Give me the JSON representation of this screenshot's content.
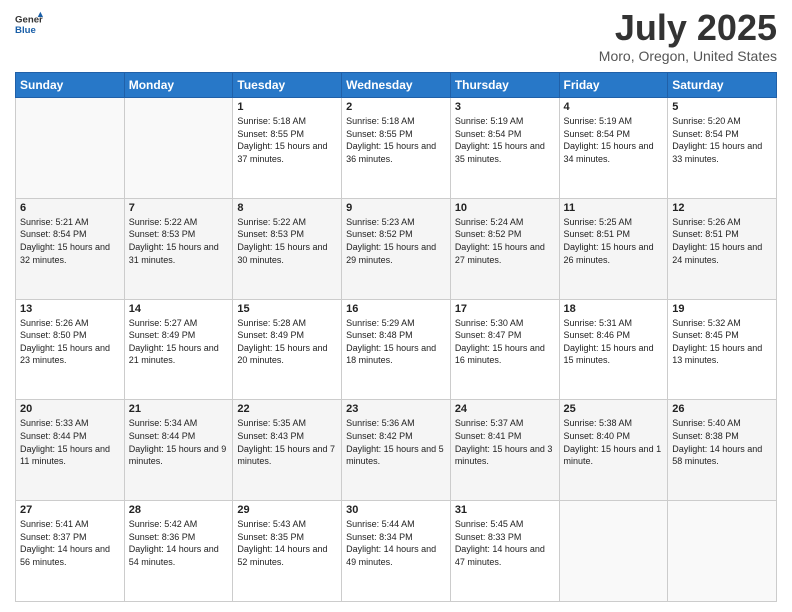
{
  "header": {
    "logo_line1": "General",
    "logo_line2": "Blue",
    "month": "July 2025",
    "location": "Moro, Oregon, United States"
  },
  "weekdays": [
    "Sunday",
    "Monday",
    "Tuesday",
    "Wednesday",
    "Thursday",
    "Friday",
    "Saturday"
  ],
  "weeks": [
    [
      {
        "day": "",
        "sunrise": "",
        "sunset": "",
        "daylight": ""
      },
      {
        "day": "",
        "sunrise": "",
        "sunset": "",
        "daylight": ""
      },
      {
        "day": "1",
        "sunrise": "Sunrise: 5:18 AM",
        "sunset": "Sunset: 8:55 PM",
        "daylight": "Daylight: 15 hours and 37 minutes."
      },
      {
        "day": "2",
        "sunrise": "Sunrise: 5:18 AM",
        "sunset": "Sunset: 8:55 PM",
        "daylight": "Daylight: 15 hours and 36 minutes."
      },
      {
        "day": "3",
        "sunrise": "Sunrise: 5:19 AM",
        "sunset": "Sunset: 8:54 PM",
        "daylight": "Daylight: 15 hours and 35 minutes."
      },
      {
        "day": "4",
        "sunrise": "Sunrise: 5:19 AM",
        "sunset": "Sunset: 8:54 PM",
        "daylight": "Daylight: 15 hours and 34 minutes."
      },
      {
        "day": "5",
        "sunrise": "Sunrise: 5:20 AM",
        "sunset": "Sunset: 8:54 PM",
        "daylight": "Daylight: 15 hours and 33 minutes."
      }
    ],
    [
      {
        "day": "6",
        "sunrise": "Sunrise: 5:21 AM",
        "sunset": "Sunset: 8:54 PM",
        "daylight": "Daylight: 15 hours and 32 minutes."
      },
      {
        "day": "7",
        "sunrise": "Sunrise: 5:22 AM",
        "sunset": "Sunset: 8:53 PM",
        "daylight": "Daylight: 15 hours and 31 minutes."
      },
      {
        "day": "8",
        "sunrise": "Sunrise: 5:22 AM",
        "sunset": "Sunset: 8:53 PM",
        "daylight": "Daylight: 15 hours and 30 minutes."
      },
      {
        "day": "9",
        "sunrise": "Sunrise: 5:23 AM",
        "sunset": "Sunset: 8:52 PM",
        "daylight": "Daylight: 15 hours and 29 minutes."
      },
      {
        "day": "10",
        "sunrise": "Sunrise: 5:24 AM",
        "sunset": "Sunset: 8:52 PM",
        "daylight": "Daylight: 15 hours and 27 minutes."
      },
      {
        "day": "11",
        "sunrise": "Sunrise: 5:25 AM",
        "sunset": "Sunset: 8:51 PM",
        "daylight": "Daylight: 15 hours and 26 minutes."
      },
      {
        "day": "12",
        "sunrise": "Sunrise: 5:26 AM",
        "sunset": "Sunset: 8:51 PM",
        "daylight": "Daylight: 15 hours and 24 minutes."
      }
    ],
    [
      {
        "day": "13",
        "sunrise": "Sunrise: 5:26 AM",
        "sunset": "Sunset: 8:50 PM",
        "daylight": "Daylight: 15 hours and 23 minutes."
      },
      {
        "day": "14",
        "sunrise": "Sunrise: 5:27 AM",
        "sunset": "Sunset: 8:49 PM",
        "daylight": "Daylight: 15 hours and 21 minutes."
      },
      {
        "day": "15",
        "sunrise": "Sunrise: 5:28 AM",
        "sunset": "Sunset: 8:49 PM",
        "daylight": "Daylight: 15 hours and 20 minutes."
      },
      {
        "day": "16",
        "sunrise": "Sunrise: 5:29 AM",
        "sunset": "Sunset: 8:48 PM",
        "daylight": "Daylight: 15 hours and 18 minutes."
      },
      {
        "day": "17",
        "sunrise": "Sunrise: 5:30 AM",
        "sunset": "Sunset: 8:47 PM",
        "daylight": "Daylight: 15 hours and 16 minutes."
      },
      {
        "day": "18",
        "sunrise": "Sunrise: 5:31 AM",
        "sunset": "Sunset: 8:46 PM",
        "daylight": "Daylight: 15 hours and 15 minutes."
      },
      {
        "day": "19",
        "sunrise": "Sunrise: 5:32 AM",
        "sunset": "Sunset: 8:45 PM",
        "daylight": "Daylight: 15 hours and 13 minutes."
      }
    ],
    [
      {
        "day": "20",
        "sunrise": "Sunrise: 5:33 AM",
        "sunset": "Sunset: 8:44 PM",
        "daylight": "Daylight: 15 hours and 11 minutes."
      },
      {
        "day": "21",
        "sunrise": "Sunrise: 5:34 AM",
        "sunset": "Sunset: 8:44 PM",
        "daylight": "Daylight: 15 hours and 9 minutes."
      },
      {
        "day": "22",
        "sunrise": "Sunrise: 5:35 AM",
        "sunset": "Sunset: 8:43 PM",
        "daylight": "Daylight: 15 hours and 7 minutes."
      },
      {
        "day": "23",
        "sunrise": "Sunrise: 5:36 AM",
        "sunset": "Sunset: 8:42 PM",
        "daylight": "Daylight: 15 hours and 5 minutes."
      },
      {
        "day": "24",
        "sunrise": "Sunrise: 5:37 AM",
        "sunset": "Sunset: 8:41 PM",
        "daylight": "Daylight: 15 hours and 3 minutes."
      },
      {
        "day": "25",
        "sunrise": "Sunrise: 5:38 AM",
        "sunset": "Sunset: 8:40 PM",
        "daylight": "Daylight: 15 hours and 1 minute."
      },
      {
        "day": "26",
        "sunrise": "Sunrise: 5:40 AM",
        "sunset": "Sunset: 8:38 PM",
        "daylight": "Daylight: 14 hours and 58 minutes."
      }
    ],
    [
      {
        "day": "27",
        "sunrise": "Sunrise: 5:41 AM",
        "sunset": "Sunset: 8:37 PM",
        "daylight": "Daylight: 14 hours and 56 minutes."
      },
      {
        "day": "28",
        "sunrise": "Sunrise: 5:42 AM",
        "sunset": "Sunset: 8:36 PM",
        "daylight": "Daylight: 14 hours and 54 minutes."
      },
      {
        "day": "29",
        "sunrise": "Sunrise: 5:43 AM",
        "sunset": "Sunset: 8:35 PM",
        "daylight": "Daylight: 14 hours and 52 minutes."
      },
      {
        "day": "30",
        "sunrise": "Sunrise: 5:44 AM",
        "sunset": "Sunset: 8:34 PM",
        "daylight": "Daylight: 14 hours and 49 minutes."
      },
      {
        "day": "31",
        "sunrise": "Sunrise: 5:45 AM",
        "sunset": "Sunset: 8:33 PM",
        "daylight": "Daylight: 14 hours and 47 minutes."
      },
      {
        "day": "",
        "sunrise": "",
        "sunset": "",
        "daylight": ""
      },
      {
        "day": "",
        "sunrise": "",
        "sunset": "",
        "daylight": ""
      }
    ]
  ]
}
